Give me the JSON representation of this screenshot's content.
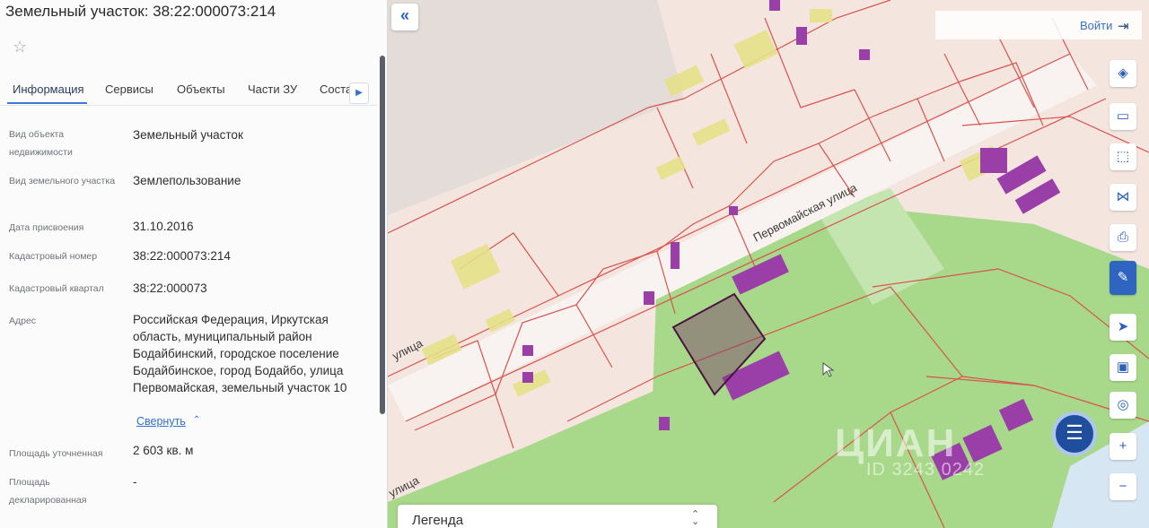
{
  "panel": {
    "title": "Земельный участок: 38:22:000073:214",
    "tabs": [
      "Информация",
      "Сервисы",
      "Объекты",
      "Части ЗУ",
      "Соста"
    ],
    "rows": [
      {
        "label": "Вид объекта недвижимости",
        "value": "Земельный участок"
      },
      {
        "label": "Вид земельного участка",
        "value": "Землепользование"
      },
      {
        "label": "Дата присвоения",
        "value": "31.10.2016"
      },
      {
        "label": "Кадастровый номер",
        "value": "38:22:000073:214"
      },
      {
        "label": "Кадастровый квартал",
        "value": "38:22:000073"
      },
      {
        "label": "Адрес",
        "value": "Российская Федерация, Иркутская область, муниципальный район Бодайбинский, городское поселение Бодайбинское, город Бодайбо, улица Первомайская, земельный участок 10"
      },
      {
        "label": "Площадь уточненная",
        "value": "2 603 кв. м"
      },
      {
        "label": "Площадь декларированная",
        "value": "-"
      }
    ],
    "collapse_label": "Свернуть"
  },
  "map": {
    "login_label": "Войти",
    "street_main": "Первомайская улица",
    "street_left": "улица",
    "street_bottom": "улица",
    "legend_label": "Легенда",
    "watermark": "ЦИАН",
    "watermark_id": "ID 3243 0242"
  },
  "icons": {
    "collapse": "double-chevron-left-icon",
    "login": "login-icon",
    "tools": [
      "layers-icon",
      "ruler-icon",
      "area-select-icon",
      "share-icon",
      "print-icon",
      "feedback-icon",
      "locate-icon",
      "screen-icon",
      "search-map-icon",
      "zoom-in-icon",
      "zoom-out-icon"
    ]
  },
  "colors": {
    "accent": "#2f64c0",
    "parcel_line": "#d9534f",
    "selected_parcel": "#5a1a4a",
    "building": "#9b3fa8",
    "green_zone": "#9fd37a"
  }
}
